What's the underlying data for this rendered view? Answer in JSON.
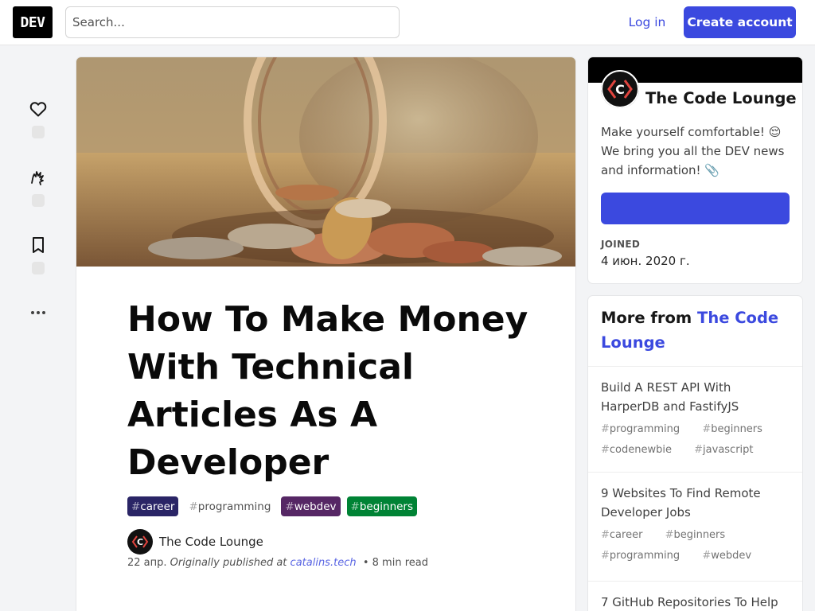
{
  "header": {
    "logo_text": "DEV",
    "search_placeholder": "Search...",
    "login_label": "Log in",
    "create_label": "Create account"
  },
  "colors": {
    "accent": "#3b49df",
    "tag_career": "#2a2566",
    "tag_webdev": "#562765",
    "tag_beginners": "#008335"
  },
  "rail": {
    "icons": [
      "heart-icon",
      "unicorn-icon",
      "bookmark-icon",
      "more-icon"
    ]
  },
  "article": {
    "title": "How To Make Money With Technical Articles As A Developer",
    "tags": [
      {
        "hash": "#",
        "name": "career"
      },
      {
        "hash": "#",
        "name": "programming"
      },
      {
        "hash": "#",
        "name": "webdev"
      },
      {
        "hash": "#",
        "name": "beginners"
      }
    ],
    "author": "The Code Lounge",
    "date": "22 апр.",
    "published_prefix": "Originally published at",
    "published_site": "catalins.tech",
    "read_time": "8 min read"
  },
  "org": {
    "name": "The Code Lounge",
    "description_line1": "Make yourself comfortable! 😌",
    "description_line2": "We bring you all the DEV news and information! 📎",
    "joined_label": "JOINED",
    "joined_date": "4 июн. 2020 г."
  },
  "more": {
    "heading_prefix": "More from",
    "heading_org": "The Code Lounge",
    "items": [
      {
        "title": "Build A REST API With HarperDB and FastifyJS",
        "tags": [
          "programming",
          "beginners",
          "codenewbie",
          "javascript"
        ]
      },
      {
        "title": "9 Websites To Find Remote Developer Jobs",
        "tags": [
          "career",
          "beginners",
          "programming",
          "webdev"
        ]
      },
      {
        "title": "7 GitHub Repositories To Help",
        "tags": []
      }
    ]
  }
}
